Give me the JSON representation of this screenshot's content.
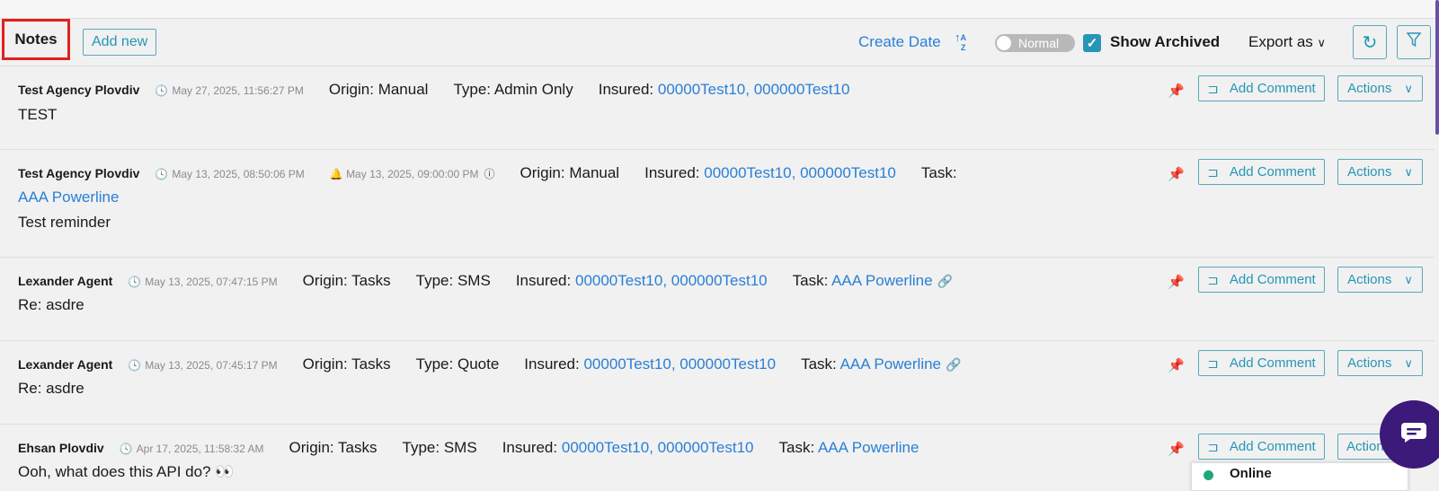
{
  "header": {
    "title": "Notes",
    "add_new_label": "Add new",
    "sort_label": "Create Date",
    "sort_icon": "sort-az-icon",
    "toggle_label": "Normal",
    "show_archived_label": "Show Archived",
    "show_archived_checked": true,
    "export_label": "Export as",
    "refresh_icon": "refresh-icon",
    "filter_icon": "filter-icon"
  },
  "notes": [
    {
      "author": "Test Agency Plovdiv",
      "timestamp": "May 27, 2025, 11:56:27 PM",
      "origin_label": "Origin:",
      "origin": "Manual",
      "type_label": "Type:",
      "type": "Admin Only",
      "insured_label": "Insured:",
      "insured": "00000Test10, 000000Test10",
      "body": "TEST"
    },
    {
      "author": "Test Agency Plovdiv",
      "timestamp": "May 13, 2025, 08:50:06 PM",
      "reminder": "May 13, 2025, 09:00:00 PM",
      "origin_label": "Origin:",
      "origin": "Manual",
      "insured_label": "Insured:",
      "insured": "00000Test10, 000000Test10",
      "task_label": "Task:",
      "task": "AAA Powerline",
      "body": "Test reminder"
    },
    {
      "author": "Lexander Agent",
      "timestamp": "May 13, 2025, 07:47:15 PM",
      "origin_label": "Origin:",
      "origin": "Tasks",
      "type_label": "Type:",
      "type": "SMS",
      "insured_label": "Insured:",
      "insured": "00000Test10, 000000Test10",
      "task_label": "Task:",
      "task": "AAA Powerline",
      "body": "Re: asdre"
    },
    {
      "author": "Lexander Agent",
      "timestamp": "May 13, 2025, 07:45:17 PM",
      "origin_label": "Origin:",
      "origin": "Tasks",
      "type_label": "Type:",
      "type": "Quote",
      "insured_label": "Insured:",
      "insured": "00000Test10, 000000Test10",
      "task_label": "Task:",
      "task": "AAA Powerline",
      "body": "Re: asdre"
    },
    {
      "author": "Ehsan Plovdiv",
      "timestamp": "Apr 17, 2025, 11:58:32 AM",
      "origin_label": "Origin:",
      "origin": "Tasks",
      "type_label": "Type:",
      "type": "SMS",
      "insured_label": "Insured:",
      "insured": "00000Test10, 000000Test10",
      "task_label": "Task:",
      "task": "AAA Powerline",
      "body": "Ooh, what does this API do? 👀"
    }
  ],
  "row_actions": {
    "add_comment_label": "Add Comment",
    "actions_label": "Actions",
    "actions_last_label": "Action"
  },
  "chat": {
    "status_label": "Online",
    "status_color": "#21a67a",
    "bubble_color": "#3b1a7a"
  }
}
